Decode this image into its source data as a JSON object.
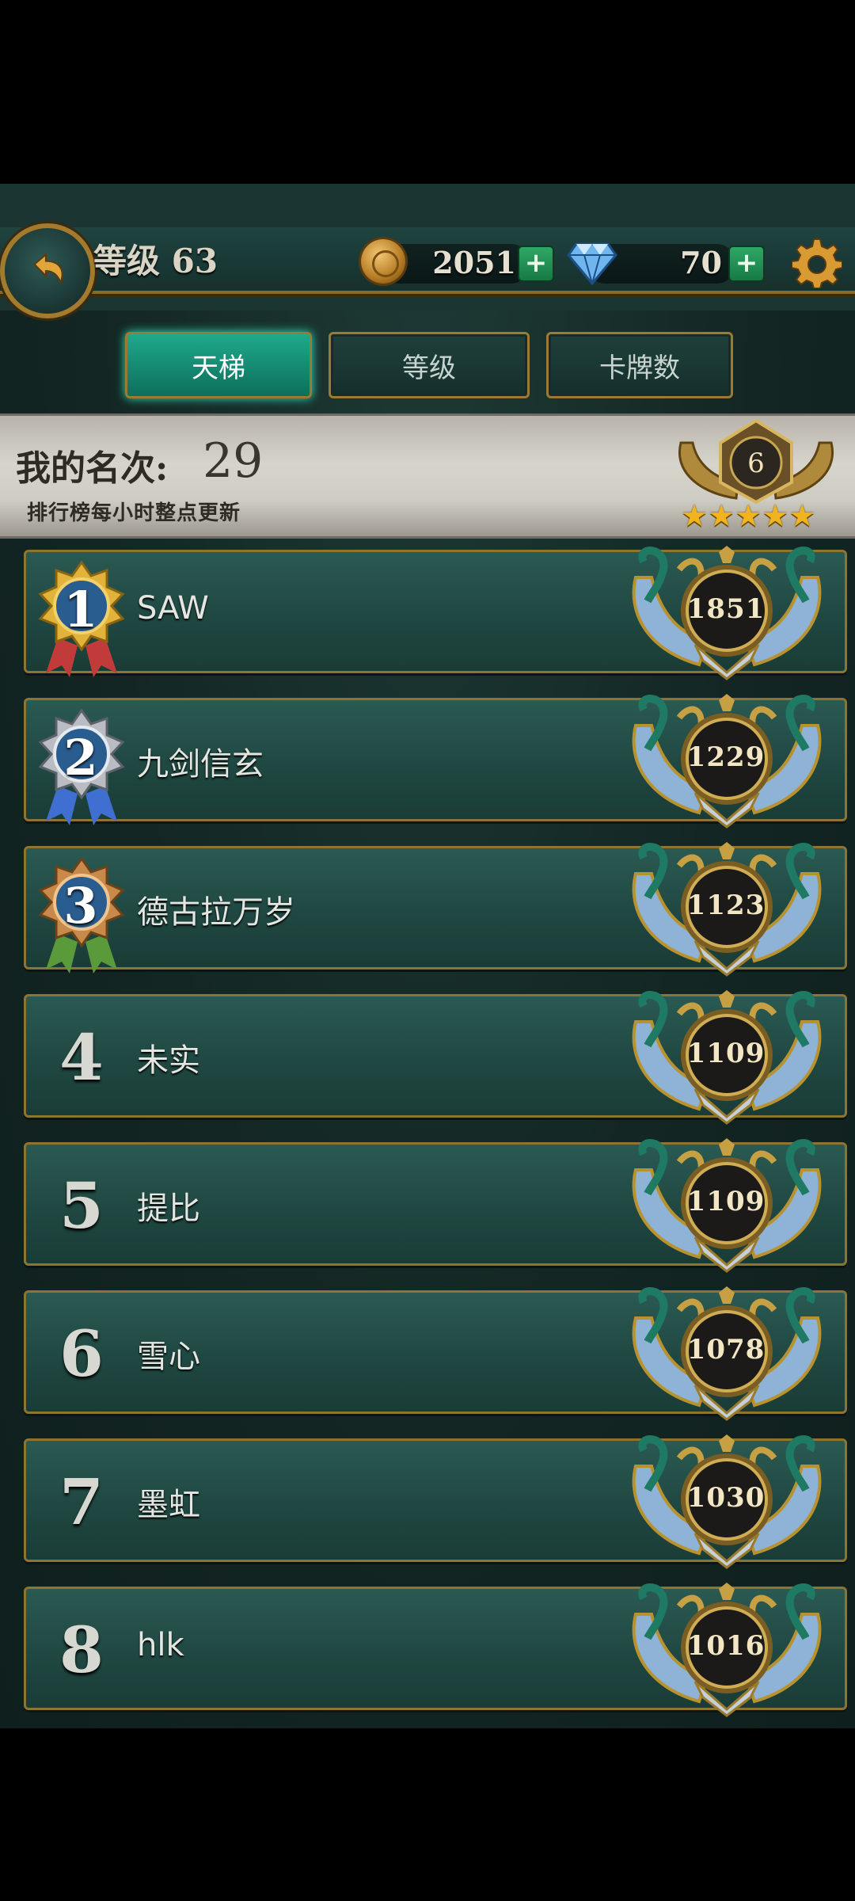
{
  "header": {
    "level_text": "等级 63",
    "coins": "2051",
    "gems": "70",
    "plus_label": "+"
  },
  "tabs": [
    {
      "label": "天梯",
      "active": true
    },
    {
      "label": "等级",
      "active": false
    },
    {
      "label": "卡牌数",
      "active": false
    }
  ],
  "my_rank": {
    "label": "我的名次:",
    "value": "29",
    "note": "排行榜每小时整点更新",
    "tier": "6",
    "stars": 5,
    "stars_text": "★★★★★"
  },
  "rankings": [
    {
      "rank": "1",
      "name": "SAW",
      "score": "1851"
    },
    {
      "rank": "2",
      "name": "九剑信玄",
      "score": "1229"
    },
    {
      "rank": "3",
      "name": "德古拉万岁",
      "score": "1123"
    },
    {
      "rank": "4",
      "name": "未实",
      "score": "1109"
    },
    {
      "rank": "5",
      "name": "提比",
      "score": "1109"
    },
    {
      "rank": "6",
      "name": "雪心",
      "score": "1078"
    },
    {
      "rank": "7",
      "name": "墨虹",
      "score": "1030"
    },
    {
      "rank": "8",
      "name": "hlk",
      "score": "1016"
    }
  ],
  "colors": {
    "accent_tab": "#1fa98c",
    "gold_border": "#8d7432",
    "row_bg": "#1f4640"
  },
  "icons": [
    "back-arrow-icon",
    "coin-icon",
    "diamond-icon",
    "gear-icon",
    "plus-icon",
    "medal-icon",
    "rank-emblem-icon",
    "star-icon"
  ]
}
